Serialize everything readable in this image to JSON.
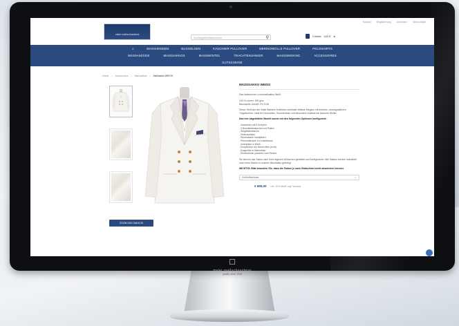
{
  "header": {
    "top_links": [
      "Kontakt",
      "Registrierung",
      "Anmelden",
      "Wunschliste"
    ],
    "logo_text": "meler maßschneiderei",
    "search_placeholder": "Suchbegriff/Artikelnummer",
    "cart_label": "0 Artikel",
    "cart_total": "0,00 €"
  },
  "nav": {
    "row1": [
      "MASSHEMDEN",
      "BUGGELSEN",
      "KASCHMIR PULLOVER",
      "MERINOWOLLE PULLOVER",
      "POLOSHIRTS"
    ],
    "row2": [
      "MASSANZÜGE",
      "MASSSAKKOS",
      "MASSMÄNTEL",
      "TRACHTENJANKER",
      "MASSSMOKING",
      "ACCESSOIRES"
    ],
    "row3": [
      "GUTSCHEINE"
    ]
  },
  "breadcrumb": [
    "Home",
    "Accessoires",
    "Maßsakkos",
    "Maßsakko WEISS"
  ],
  "gallery": {
    "zoom_button": "ZOOM DAS SAKKOS"
  },
  "product": {
    "title": "MASSSAKKO WEISS",
    "subtitle": "Das italienische Luxusmaßsakko Weiß",
    "specs": [
      "100 % Leinen: 290 g/m²",
      "Baumwolle-Gehalt: 2% 2016"
    ],
    "para1": "Dieser Stoff aus der Vitale Barberis Kollektion verbindet zeitlose Eleganz mit leichtem, atmungsaktivem Tragekomfort. Ideal für Hochzeiten, Sommerfeste und besondere Anlässe bei warmem Wetter.",
    "bold1": "Das hier abgebildete Modell wurde mit den folgenden Optionen konfiguriert:",
    "options": [
      "- Zweireiher mit 6 Knöpfen",
      "- 2 Brustleistentaschen mit Patten",
      "- Stegleistentasche",
      "- Seitenschlitze",
      "- Reverskante handpikiert",
      "- Perlmuttknöpfe in Dunkelbraun",
      "- Innenfutter in Weiß",
      "- Knopflöcher am Ärmel offen (echt)",
      "- Kragenfilz in Marineblau",
      "- Einstecktuch passend zum Revers"
    ],
    "para2": "Sie können das Sakko nach Ihren eigenen Wünschen gestalten und konfigurieren. Alle Sakkos werden individuell nach Ihren Maßen in unserer Manufaktur gefertigt.",
    "bold2": "WICHTIG: Bitte beachten Sie, dass die Farben je nach Bildschirm leicht abweichen können.",
    "select_label": "Größe/Maßwahl",
    "price": "€ 695,00",
    "vat": "inkl. 19 % MwSt. zzgl. Versand"
  },
  "chin": {
    "brand": "meler maßschneiderei",
    "tagline": "quality since 1938"
  }
}
